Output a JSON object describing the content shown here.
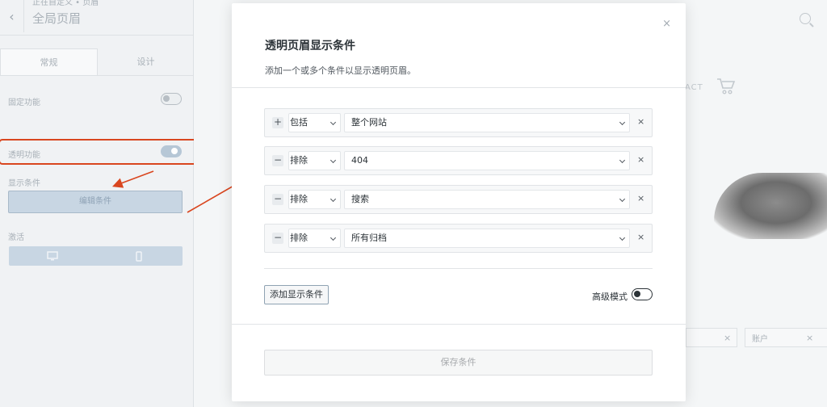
{
  "sidebar": {
    "breadcrumb": "正在自定义 • 页眉",
    "title": "全局页眉",
    "tabs": [
      "常规",
      "设计"
    ],
    "sticky_label": "固定功能",
    "transparent_label": "透明功能",
    "display_conditions_label": "显示条件",
    "edit_conditions_button": "编辑条件",
    "activate_label": "激活"
  },
  "background": {
    "contact_text": "ACT",
    "chip_text": "账户"
  },
  "modal": {
    "title": "透明页眉显示条件",
    "description": "添加一个或多个条件以显示透明页眉。",
    "conditions": [
      {
        "sign": "+",
        "type": "包括",
        "value": "整个网站"
      },
      {
        "sign": "−",
        "type": "排除",
        "value": "404"
      },
      {
        "sign": "−",
        "type": "排除",
        "value": "搜索"
      },
      {
        "sign": "−",
        "type": "排除",
        "value": "所有归档"
      }
    ],
    "remove_glyph": "×",
    "add_condition_button": "添加显示条件",
    "advanced_mode_label": "高级模式",
    "advanced_mode_on": false,
    "save_button": "保存条件",
    "close_glyph": "×"
  },
  "colors": {
    "annotation_red": "#d9461f",
    "modal_bg": "#ffffff",
    "disabled_text": "#a7aaad"
  },
  "icons": [
    "back-arrow-icon",
    "desktop-icon",
    "mobile-icon",
    "search-icon",
    "cart-icon",
    "close-icon",
    "chevron-down-icon"
  ]
}
